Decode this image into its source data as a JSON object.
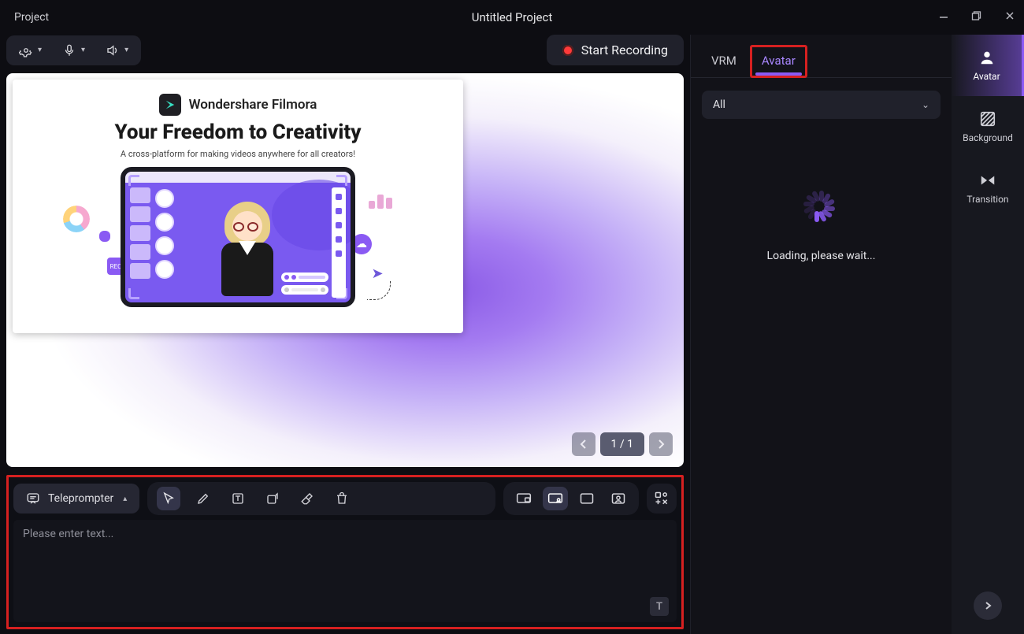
{
  "titlebar": {
    "menu_project": "Project",
    "title": "Untitled Project"
  },
  "toolbar": {
    "record_label": "Start Recording"
  },
  "canvas": {
    "brand": "Wondershare Filmora",
    "headline": "Your Freedom to Creativity",
    "subhead": "A cross-platform for making videos anywhere for all creators!",
    "pager": "1 / 1"
  },
  "bottom": {
    "teleprompter_label": "Teleprompter",
    "placeholder": "Please enter text..."
  },
  "right_panel": {
    "tabs": {
      "vrm": "VRM",
      "avatar": "Avatar"
    },
    "dropdown_selected": "All",
    "loading_text": "Loading, please wait..."
  },
  "rightmost": {
    "avatar": "Avatar",
    "background": "Background",
    "transition": "Transition"
  }
}
